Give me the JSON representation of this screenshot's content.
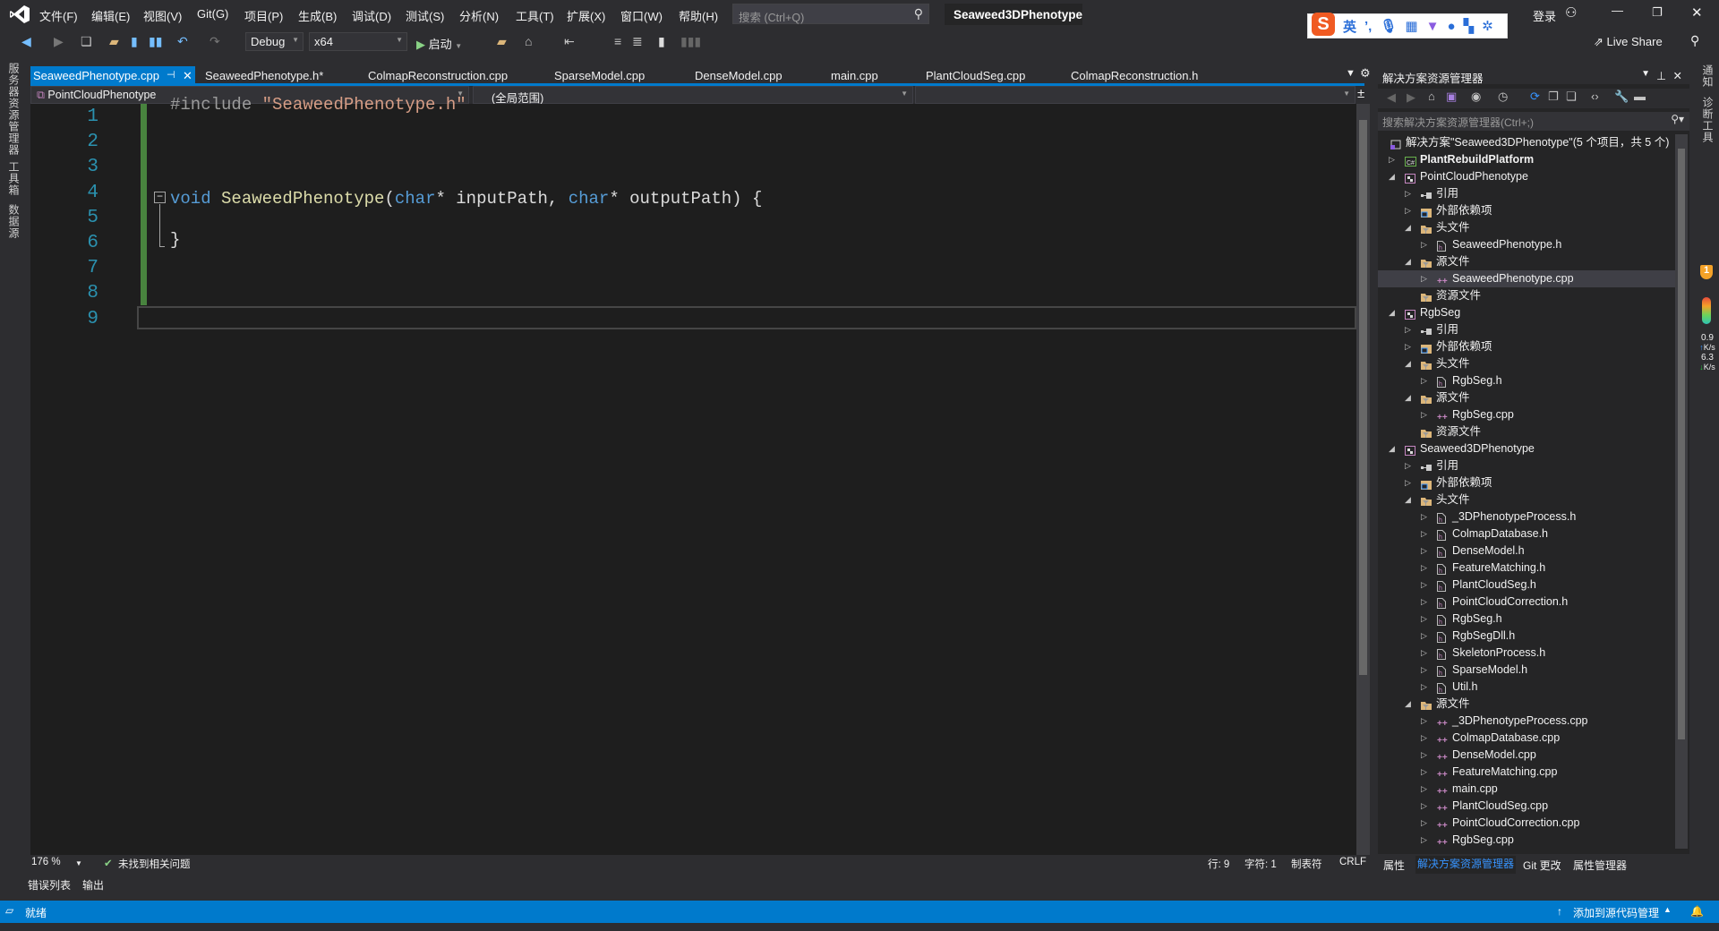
{
  "colors": {
    "accent": "#007acc",
    "editor_bg": "#1e1e1e",
    "line_number": "#2b91af",
    "keyword": "#569cd6",
    "function": "#dcdcaa",
    "string": "#d69d85",
    "preprocessor": "#9b9b9b"
  },
  "menu": {
    "items": [
      "文件(F)",
      "编辑(E)",
      "视图(V)",
      "Git(G)",
      "项目(P)",
      "生成(B)",
      "调试(D)",
      "测试(S)",
      "分析(N)",
      "工具(T)",
      "扩展(X)",
      "窗口(W)",
      "帮助(H)"
    ],
    "search_placeholder": "搜索 (Ctrl+Q)",
    "solution_title": "Seaweed3DPhenotype",
    "login": "登录"
  },
  "ime": {
    "mode": "英"
  },
  "toolbar": {
    "config": "Debug",
    "platform": "x64",
    "start": "启动",
    "live_share": "Live Share"
  },
  "left_strip": [
    "服务器资源管理器",
    "工具箱",
    "数据源"
  ],
  "right_strip": [
    "通知",
    "诊断工具"
  ],
  "right_widget": {
    "badge": "1",
    "up_speed": "0.9",
    "up_unit": "K/s",
    "down_speed": "6.3",
    "down_unit": "K/s"
  },
  "tabs": [
    {
      "label": "SeaweedPhenotype.cpp",
      "active": true
    },
    {
      "label": "SeaweedPhenotype.h*"
    },
    {
      "label": "ColmapReconstruction.cpp"
    },
    {
      "label": "SparseModel.cpp"
    },
    {
      "label": "DenseModel.cpp"
    },
    {
      "label": "main.cpp"
    },
    {
      "label": "PlantCloudSeg.cpp"
    },
    {
      "label": "ColmapReconstruction.h"
    }
  ],
  "navbar": {
    "project": "PointCloudPhenotype",
    "scope": "(全局范围)",
    "member": ""
  },
  "editor": {
    "line_numbers": [
      "1",
      "2",
      "3",
      "4",
      "5",
      "6",
      "7",
      "8",
      "9"
    ],
    "line1": {
      "directive": "#include ",
      "string": "\"SeaweedPhenotype.h\""
    },
    "line6": {
      "kw1": "void",
      "fn": " SeaweedPhenotype",
      "p1": "(",
      "kw2": "char",
      "a1": "* inputPath, ",
      "kw3": "char",
      "a2": "* outputPath) {"
    },
    "line8": "}"
  },
  "editor_status": {
    "zoom": "176 %",
    "issues": "未找到相关问题",
    "line": "行: 9",
    "char": "字符: 1",
    "tabs": "制表符",
    "eol": "CRLF"
  },
  "bottom_tabs": [
    "错误列表",
    "输出"
  ],
  "status": {
    "ready": "就绪",
    "source_control": "添加到源代码管理"
  },
  "solution_explorer": {
    "title": "解决方案资源管理器",
    "search_placeholder": "搜索解决方案资源管理器(Ctrl+;)",
    "tree": [
      {
        "label": "解决方案\"Seaweed3DPhenotype\"(5 个项目，共 5 个)",
        "level": -1,
        "exp": "none",
        "icon": "solution"
      },
      {
        "label": "PlantRebuildPlatform",
        "level": 0,
        "exp": "collapsed",
        "icon": "csharp-project",
        "bold": true
      },
      {
        "label": "PointCloudPhenotype",
        "level": 0,
        "exp": "expanded",
        "icon": "cpp-project"
      },
      {
        "label": "引用",
        "level": 1,
        "exp": "collapsed",
        "icon": "references"
      },
      {
        "label": "外部依赖项",
        "level": 1,
        "exp": "collapsed",
        "icon": "external-deps"
      },
      {
        "label": "头文件",
        "level": 1,
        "exp": "expanded",
        "icon": "filter-folder"
      },
      {
        "label": "SeaweedPhenotype.h",
        "level": 2,
        "exp": "collapsed",
        "icon": "header-file"
      },
      {
        "label": "源文件",
        "level": 1,
        "exp": "expanded",
        "icon": "filter-folder"
      },
      {
        "label": "SeaweedPhenotype.cpp",
        "level": 2,
        "exp": "collapsed",
        "icon": "cpp-file",
        "selected": true
      },
      {
        "label": "资源文件",
        "level": 1,
        "exp": "none",
        "icon": "filter-folder"
      },
      {
        "label": "RgbSeg",
        "level": 0,
        "exp": "expanded",
        "icon": "cpp-project"
      },
      {
        "label": "引用",
        "level": 1,
        "exp": "collapsed",
        "icon": "references"
      },
      {
        "label": "外部依赖项",
        "level": 1,
        "exp": "collapsed",
        "icon": "external-deps"
      },
      {
        "label": "头文件",
        "level": 1,
        "exp": "expanded",
        "icon": "filter-folder"
      },
      {
        "label": "RgbSeg.h",
        "level": 2,
        "exp": "collapsed",
        "icon": "header-file"
      },
      {
        "label": "源文件",
        "level": 1,
        "exp": "expanded",
        "icon": "filter-folder"
      },
      {
        "label": "RgbSeg.cpp",
        "level": 2,
        "exp": "collapsed",
        "icon": "cpp-file"
      },
      {
        "label": "资源文件",
        "level": 1,
        "exp": "none",
        "icon": "filter-folder"
      },
      {
        "label": "Seaweed3DPhenotype",
        "level": 0,
        "exp": "expanded",
        "icon": "cpp-project"
      },
      {
        "label": "引用",
        "level": 1,
        "exp": "collapsed",
        "icon": "references"
      },
      {
        "label": "外部依赖项",
        "level": 1,
        "exp": "collapsed",
        "icon": "external-deps"
      },
      {
        "label": "头文件",
        "level": 1,
        "exp": "expanded",
        "icon": "filter-folder"
      },
      {
        "label": "_3DPhenotypeProcess.h",
        "level": 2,
        "exp": "collapsed",
        "icon": "header-file"
      },
      {
        "label": "ColmapDatabase.h",
        "level": 2,
        "exp": "collapsed",
        "icon": "header-file"
      },
      {
        "label": "DenseModel.h",
        "level": 2,
        "exp": "collapsed",
        "icon": "header-file"
      },
      {
        "label": "FeatureMatching.h",
        "level": 2,
        "exp": "collapsed",
        "icon": "header-file"
      },
      {
        "label": "PlantCloudSeg.h",
        "level": 2,
        "exp": "collapsed",
        "icon": "header-file"
      },
      {
        "label": "PointCloudCorrection.h",
        "level": 2,
        "exp": "collapsed",
        "icon": "header-file"
      },
      {
        "label": "RgbSeg.h",
        "level": 2,
        "exp": "collapsed",
        "icon": "header-file"
      },
      {
        "label": "RgbSegDll.h",
        "level": 2,
        "exp": "collapsed",
        "icon": "header-file"
      },
      {
        "label": "SkeletonProcess.h",
        "level": 2,
        "exp": "collapsed",
        "icon": "header-file"
      },
      {
        "label": "SparseModel.h",
        "level": 2,
        "exp": "collapsed",
        "icon": "header-file"
      },
      {
        "label": "Util.h",
        "level": 2,
        "exp": "collapsed",
        "icon": "header-file"
      },
      {
        "label": "源文件",
        "level": 1,
        "exp": "expanded",
        "icon": "filter-folder"
      },
      {
        "label": "_3DPhenotypeProcess.cpp",
        "level": 2,
        "exp": "collapsed",
        "icon": "cpp-file"
      },
      {
        "label": "ColmapDatabase.cpp",
        "level": 2,
        "exp": "collapsed",
        "icon": "cpp-file"
      },
      {
        "label": "DenseModel.cpp",
        "level": 2,
        "exp": "collapsed",
        "icon": "cpp-file"
      },
      {
        "label": "FeatureMatching.cpp",
        "level": 2,
        "exp": "collapsed",
        "icon": "cpp-file"
      },
      {
        "label": "main.cpp",
        "level": 2,
        "exp": "collapsed",
        "icon": "cpp-file"
      },
      {
        "label": "PlantCloudSeg.cpp",
        "level": 2,
        "exp": "collapsed",
        "icon": "cpp-file"
      },
      {
        "label": "PointCloudCorrection.cpp",
        "level": 2,
        "exp": "collapsed",
        "icon": "cpp-file"
      },
      {
        "label": "RgbSeg.cpp",
        "level": 2,
        "exp": "collapsed",
        "icon": "cpp-file"
      }
    ],
    "bottom_tabs": [
      {
        "label": "属性"
      },
      {
        "label": "解决方案资源管理器",
        "active": true
      },
      {
        "label": "Git 更改"
      },
      {
        "label": "属性管理器"
      }
    ]
  }
}
